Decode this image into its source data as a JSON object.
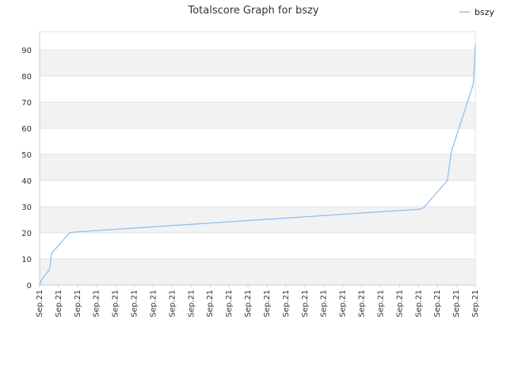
{
  "chart_data": {
    "type": "line",
    "title": "Totalscore Graph for bszy",
    "xlabel": "",
    "ylabel": "",
    "ylim": [
      0,
      97
    ],
    "yticks": [
      0,
      10,
      20,
      30,
      40,
      50,
      60,
      70,
      80,
      90
    ],
    "x_tick_labels": [
      "Sep.21",
      "Sep.21",
      "Sep.21",
      "Sep.21",
      "Sep.21",
      "Sep.21",
      "Sep.21",
      "Sep.21",
      "Sep.21",
      "Sep.21",
      "Sep.21",
      "Sep.21",
      "Sep.21",
      "Sep.21",
      "Sep.21",
      "Sep.21",
      "Sep.21",
      "Sep.21",
      "Sep.21",
      "Sep.21",
      "Sep.21",
      "Sep.21",
      "Sep.21",
      "Sep.21"
    ],
    "legend_position": "top-right",
    "grid": "horizontal alternating bands",
    "series": [
      {
        "name": "bszy",
        "color": "#90c0ee",
        "x": [
          0,
          0.5,
          2.5,
          3,
          3.5,
          7.5,
          9,
          95,
          96,
          102,
          103,
          108.5,
          109
        ],
        "values": [
          0,
          2,
          6,
          12,
          13,
          20,
          20.3,
          29,
          29.5,
          40,
          51,
          77,
          92
        ]
      }
    ]
  }
}
